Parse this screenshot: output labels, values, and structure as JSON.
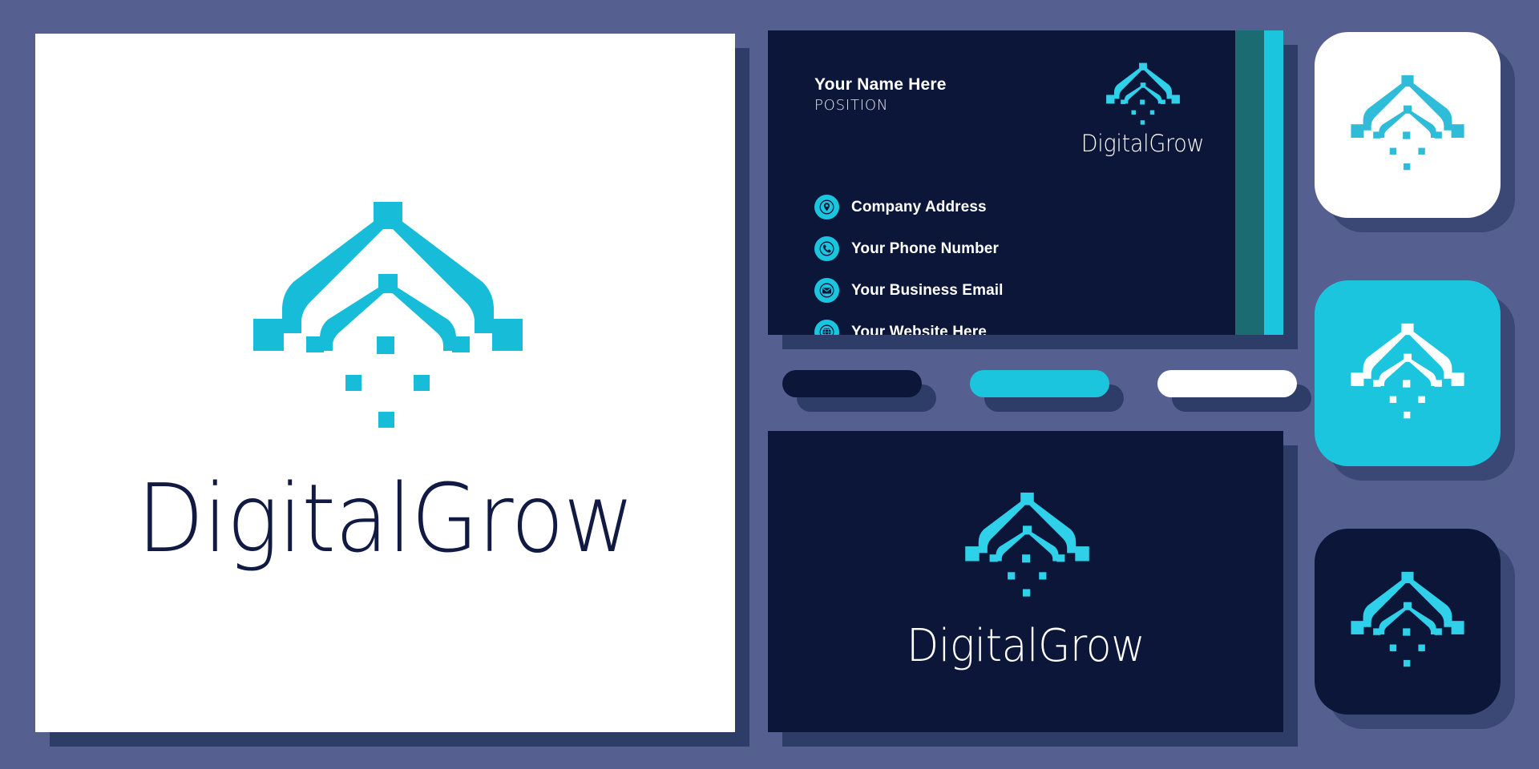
{
  "brand": {
    "name": "DigitalGrow",
    "mark_name": "digital-grow-tree-mark"
  },
  "colors": {
    "background": "#566090",
    "cyan": "#1cc5de",
    "navy": "#0c1638",
    "white": "#ffffff",
    "shadow_navy": "#2e3c68",
    "teal_outline": "#1b6b73",
    "wordmark_navy": "#101a42"
  },
  "logo_card": {
    "wordmark": "DigitalGrow"
  },
  "business_card": {
    "name": "Your Name Here",
    "position": "POSITION",
    "brand_name": "DigitalGrow",
    "contacts": [
      {
        "icon": "location-pin-icon",
        "label": "Company Address"
      },
      {
        "icon": "phone-icon",
        "label": "Your Phone Number"
      },
      {
        "icon": "envelope-icon",
        "label": "Your Business Email"
      },
      {
        "icon": "globe-icon",
        "label": "Your Website Here"
      }
    ]
  },
  "swatches": [
    {
      "name": "swatch-navy",
      "color": "#0c1638"
    },
    {
      "name": "swatch-cyan",
      "color": "#1cc5de"
    },
    {
      "name": "swatch-white",
      "color": "#ffffff"
    }
  ],
  "dark_card": {
    "wordmark": "DigitalGrow"
  },
  "icon_tiles": [
    {
      "name": "icon-tile-white",
      "background": "#ffffff",
      "mark_color": "#1cc5de"
    },
    {
      "name": "icon-tile-cyan",
      "background": "#1cc5de",
      "mark_color": "#ffffff"
    },
    {
      "name": "icon-tile-navy",
      "background": "#0c1638",
      "mark_color": "#1cc5de"
    }
  ]
}
